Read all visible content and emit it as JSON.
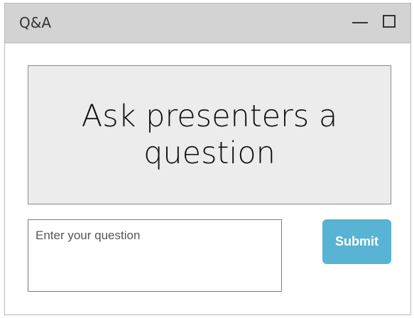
{
  "window": {
    "title": "Q&A",
    "controls": {
      "minimize_icon": "minimize-icon",
      "maximize_icon": "maximize-icon"
    }
  },
  "main": {
    "prompt": "Ask presenters a question",
    "question_input": {
      "value": "",
      "placeholder": "Enter your question"
    },
    "submit_label": "Submit"
  },
  "colors": {
    "titlebar": "#d3d3d3",
    "panel": "#ececec",
    "accent": "#58b3d4"
  }
}
